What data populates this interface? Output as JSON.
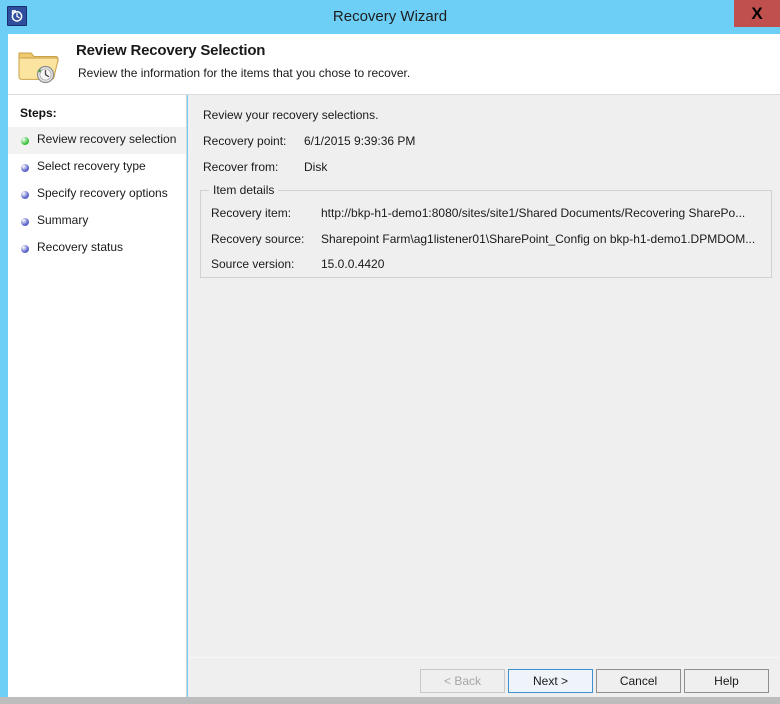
{
  "window": {
    "title": "Recovery Wizard",
    "title_icon": "recovery-clock-icon",
    "close_label": "X",
    "accent_color": "#6dcff6",
    "close_color": "#c0504d"
  },
  "header": {
    "icon": "folder-clock-icon",
    "title": "Review Recovery Selection",
    "subtitle": "Review the information for the items that you chose to recover."
  },
  "sidebar": {
    "title": "Steps:",
    "active_bullet_color": "#3cc23c",
    "pending_bullet_color": "#5b63c8",
    "items": [
      {
        "label": "Review recovery selection",
        "state": "active"
      },
      {
        "label": "Select recovery type",
        "state": "pending"
      },
      {
        "label": "Specify recovery options",
        "state": "pending"
      },
      {
        "label": "Summary",
        "state": "pending"
      },
      {
        "label": "Recovery status",
        "state": "pending"
      }
    ]
  },
  "main": {
    "intro": "Review your recovery selections.",
    "summary_rows": [
      {
        "label": "Recovery point:",
        "value": "6/1/2015 9:39:36 PM"
      },
      {
        "label": "Recover from:",
        "value": "Disk"
      }
    ],
    "item_details": {
      "legend": "Item details",
      "rows": [
        {
          "label": "Recovery item:",
          "value": "http://bkp-h1-demo1:8080/sites/site1/Shared Documents/Recovering SharePo..."
        },
        {
          "label": "Recovery source:",
          "value": "Sharepoint Farm\\ag1listener01\\SharePoint_Config on bkp-h1-demo1.DPMDOM..."
        },
        {
          "label": "Source version:",
          "value": "15.0.0.4420"
        }
      ]
    }
  },
  "footer": {
    "buttons": [
      {
        "label": "< Back",
        "state": "disabled"
      },
      {
        "label": "Next >",
        "state": "default"
      },
      {
        "label": "Cancel",
        "state": "normal"
      },
      {
        "label": "Help",
        "state": "normal"
      }
    ]
  }
}
